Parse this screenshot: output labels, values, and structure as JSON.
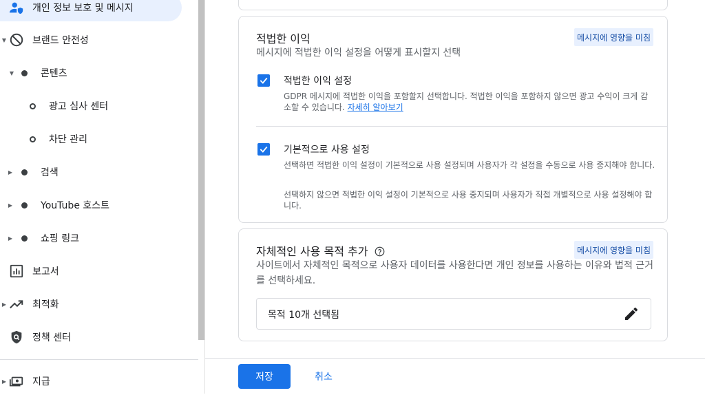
{
  "sidebar": {
    "items": [
      {
        "label": "개인 정보 보호 및 메시지",
        "icon": "person-shield-icon"
      },
      {
        "label": "브랜드 안전성",
        "icon": "block-icon"
      },
      {
        "label": "콘텐츠"
      },
      {
        "label": "광고 심사 센터"
      },
      {
        "label": "차단 관리"
      },
      {
        "label": "검색"
      },
      {
        "label": "YouTube 호스트"
      },
      {
        "label": "쇼핑 링크"
      },
      {
        "label": "보고서",
        "icon": "bar-chart-icon"
      },
      {
        "label": "최적화",
        "icon": "trending-up-icon"
      },
      {
        "label": "정책 센터",
        "icon": "policy-shield-icon"
      },
      {
        "label": "지급",
        "icon": "payments-icon"
      }
    ]
  },
  "legitimate_interest": {
    "title": "적법한 이익",
    "subtitle": "메시지에 적법한 이익 설정을 어떻게 표시할지 선택",
    "chip": "메시지에 영향을 미침",
    "option1": {
      "title": "적법한 이익 설정",
      "desc": "GDPR 메시지에 적법한 이익을 포함할지 선택합니다. 적법한 이익을 포함하지 않으면 광고 수익이 크게 감소할 수 있습니다.",
      "link": "자세히 알아보기",
      "checked": true
    },
    "option2": {
      "title": "기본적으로 사용 설정",
      "desc1": "선택하면 적법한 이익 설정이 기본적으로 사용 설정되며 사용자가 각 설정을 수동으로 사용 중지해야 합니다.",
      "desc2": "선택하지 않으면 적법한 이익 설정이 기본적으로 사용 중지되며 사용자가 직접 개별적으로 사용 설정해야 합니다.",
      "checked": true
    }
  },
  "purposes": {
    "title": "자체적인 사용 목적 추가",
    "chip": "메시지에 영향을 미침",
    "subtitle": "사이트에서 자체적인 목적으로 사용자 데이터를 사용한다면 개인 정보를 사용하는 이유와 법적 근거를 선택하세요.",
    "selected": "목적 10개 선택됨"
  },
  "footer": {
    "save": "저장",
    "cancel": "취소"
  },
  "colors": {
    "accent": "#1a73e8",
    "active_nav": "#e8f0fe"
  }
}
